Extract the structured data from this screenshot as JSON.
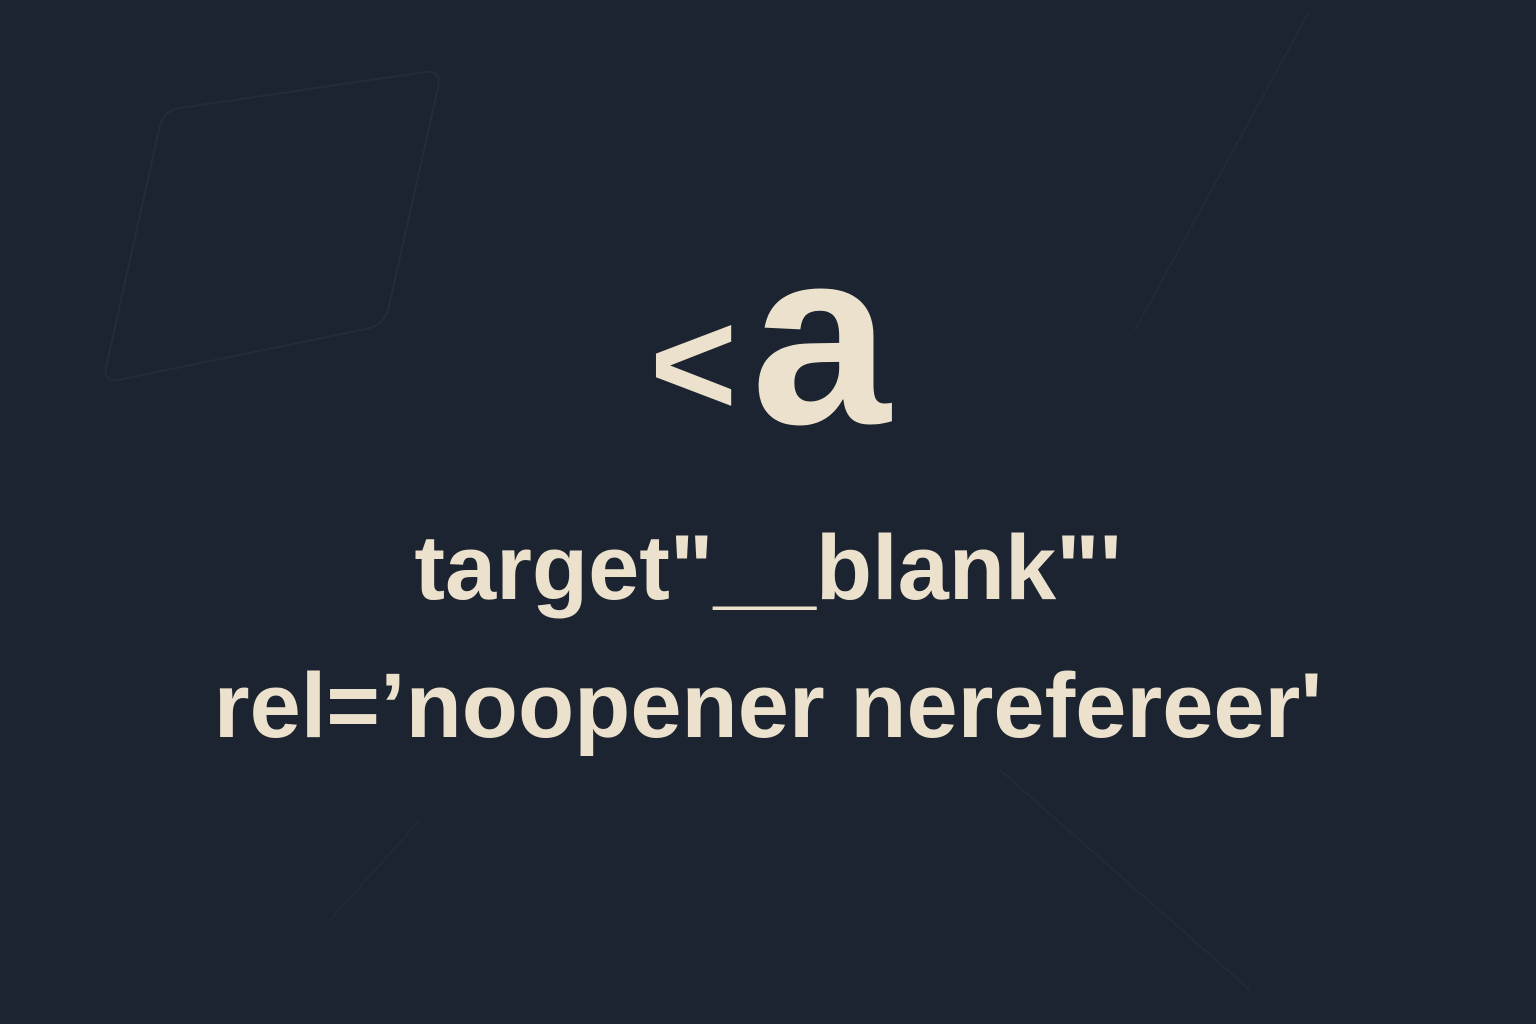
{
  "colors": {
    "background": "#1b2430",
    "text": "#ece1cc",
    "decoration": "#232d39"
  },
  "code": {
    "open_bracket": "<",
    "tag_name": "a",
    "line_1": "target\"__blank\"'",
    "line_2": "rel=’noopener nerefereer'"
  }
}
